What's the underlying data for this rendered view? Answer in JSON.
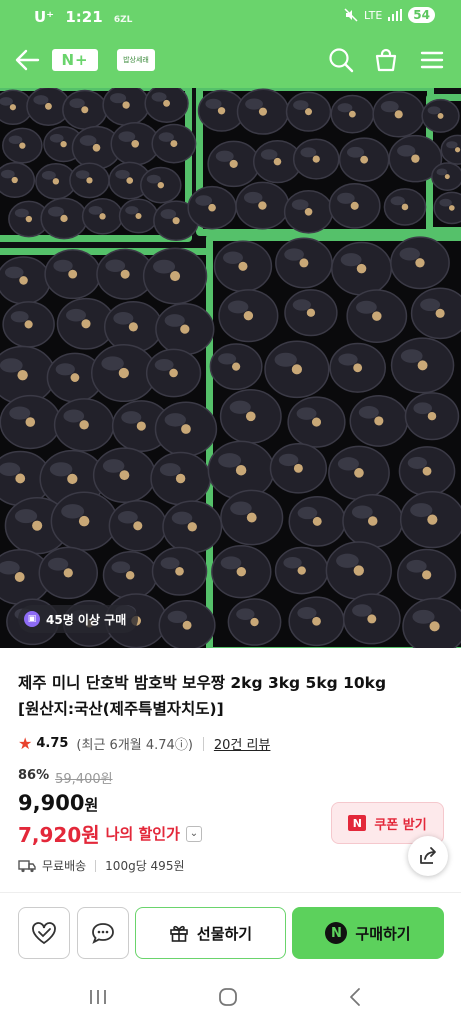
{
  "status_bar": {
    "carrier": "U⁺",
    "time": "1:21",
    "small_text": "6ZL",
    "network": "LTE",
    "battery": "54"
  },
  "header": {
    "logo": "N+",
    "store_label": "밥상세래",
    "icons": [
      "back-arrow-icon",
      "search-icon",
      "shopping-bag-icon",
      "menu-icon"
    ]
  },
  "hero": {
    "badge_text": "45명 이상 구매"
  },
  "product": {
    "title_line1": "제주 미니 단호박 밤호박 보우짱 2kg 3kg 5kg 10kg",
    "title_line2": "[원산지:국산(제주특별자치도)]",
    "rating": "4.75",
    "recent_rating": "(최근 6개월 4.74ⓘ)",
    "reviews": "20건 리뷰",
    "discount_pct": "86%",
    "original_price": "59,400원",
    "price_num": "9,900",
    "price_unit": "원",
    "my_price": "7,920원",
    "my_price_label": "나의 할인가",
    "coupon_label": "쿠폰 받기",
    "coupon_logo": "N",
    "shipping": "무료배송",
    "unit_price": "100g당 495원"
  },
  "actions": {
    "gift_label": "선물하기",
    "buy_label": "구매하기",
    "buy_logo": "N"
  },
  "colors": {
    "brand_green": "#6ad46c",
    "buy_green": "#5cd15c",
    "discount_red": "#e3283a",
    "star": "#e8422d"
  }
}
